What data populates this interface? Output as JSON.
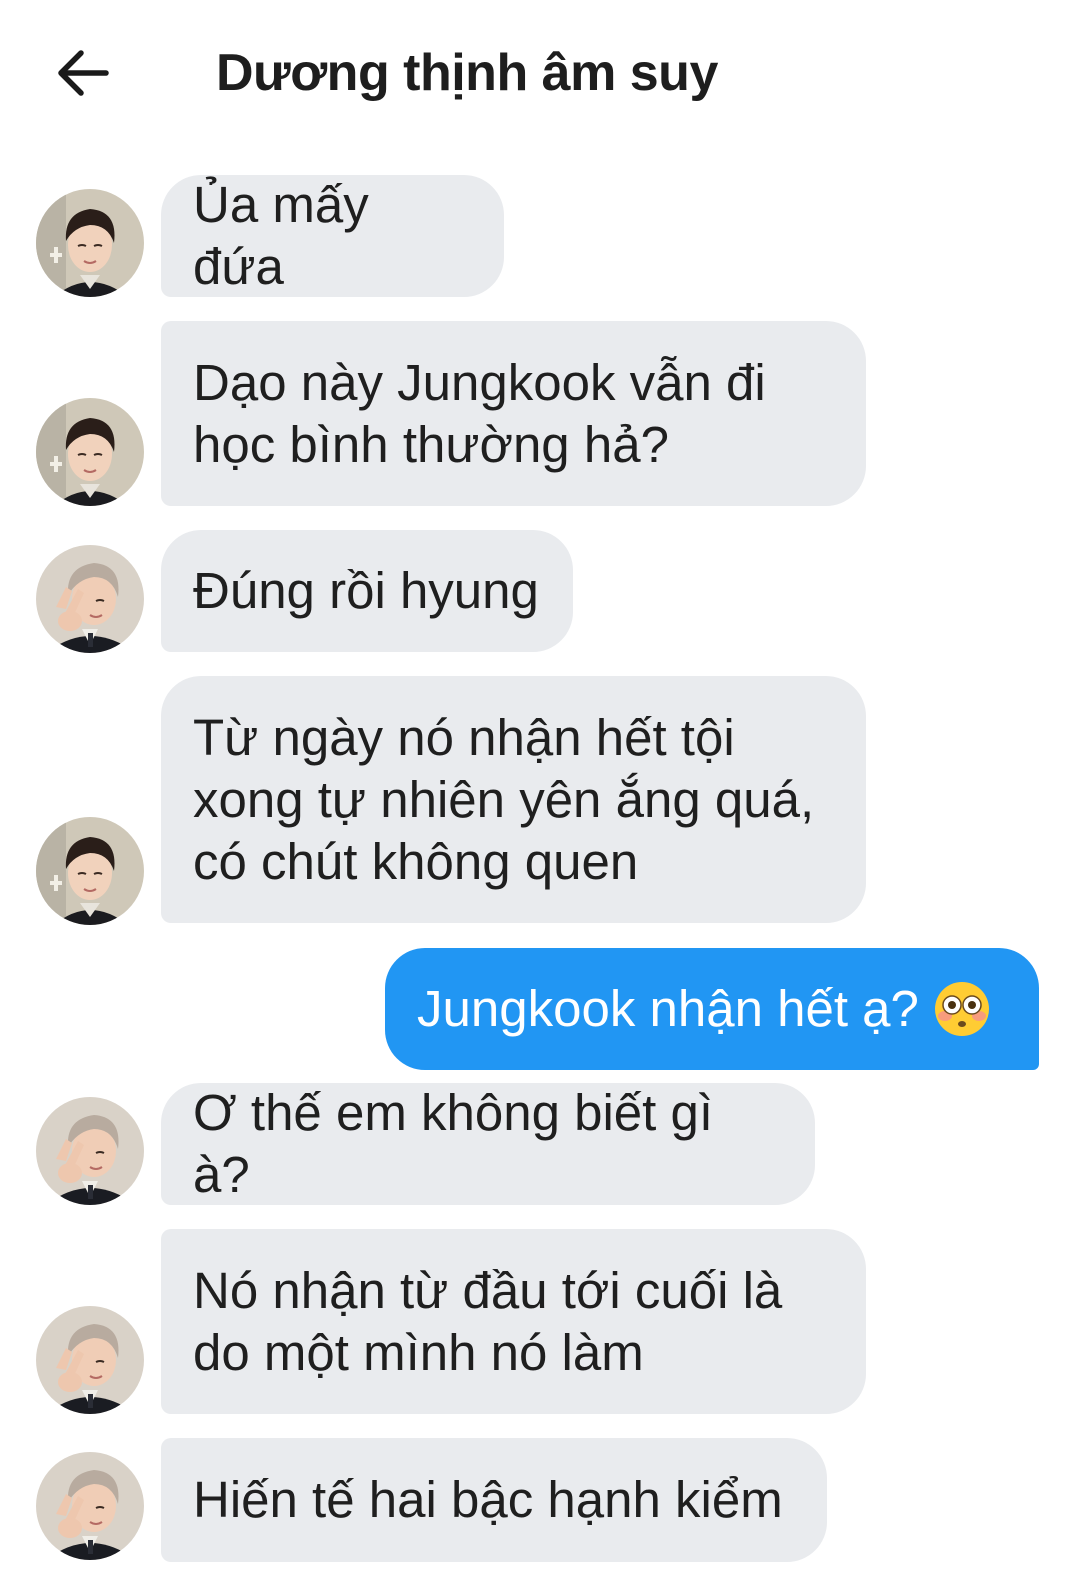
{
  "header": {
    "back_icon": "arrow-left-icon",
    "title": "Dương thịnh âm suy"
  },
  "messages": [
    {
      "side": "in",
      "sender": "Jin",
      "text": "Ủa mấy đứa"
    },
    {
      "side": "in",
      "sender": "Jin",
      "text": "Dạo này Jungkook vẫn đi học bình thường hả?"
    },
    {
      "side": "in",
      "sender": "RM",
      "text": "Đúng rồi hyung"
    },
    {
      "side": "in",
      "sender": "Jin",
      "text": "Từ ngày nó nhận hết tội xong tự nhiên yên ắng quá, có chút không quen"
    },
    {
      "side": "out",
      "sender": "me",
      "text": "Jungkook nhận hết ạ?",
      "emoji": "flushed-face-emoji"
    },
    {
      "side": "in",
      "sender": "RM",
      "text": "Ơ thế em không biết gì à?"
    },
    {
      "side": "in",
      "sender": "RM",
      "text": "Nó nhận từ đầu tới cuối là do một mình nó làm"
    },
    {
      "side": "in",
      "sender": "RM",
      "text": "Hiến tế hai bậc hạnh kiểm"
    }
  ],
  "colors": {
    "incoming_bubble": "#e9ebee",
    "outgoing_bubble": "#2196f3",
    "outgoing_text": "#ffffff"
  }
}
